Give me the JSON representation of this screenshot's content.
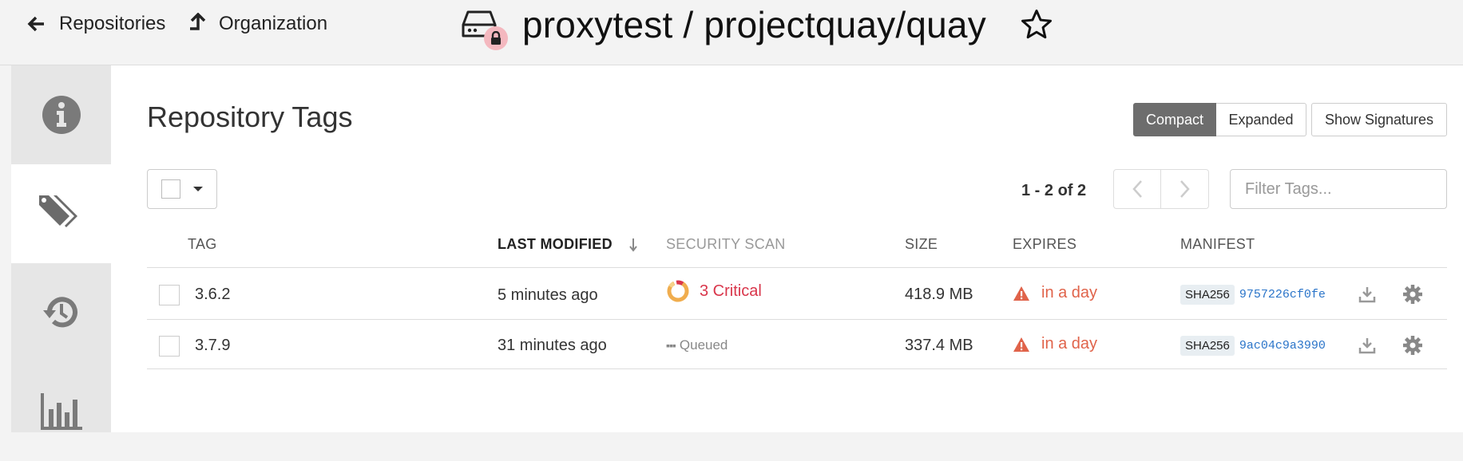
{
  "header": {
    "back_link": "Repositories",
    "org_link": "Organization",
    "repo_title": "proxytest / projectquay/quay"
  },
  "page": {
    "title": "Repository Tags",
    "view_buttons": [
      "Compact",
      "Expanded",
      "Show Signatures"
    ],
    "active_view": "Compact"
  },
  "toolbar": {
    "pager_text": "1 - 2 of 2",
    "filter_placeholder": "Filter Tags..."
  },
  "table": {
    "headers": {
      "tag": "TAG",
      "last_modified": "LAST MODIFIED",
      "security_scan": "SECURITY SCAN",
      "size": "SIZE",
      "expires": "EXPIRES",
      "manifest": "MANIFEST"
    },
    "rows": [
      {
        "tag": "3.6.2",
        "last_modified": "5 minutes ago",
        "security_scan": "3 Critical",
        "size": "418.9 MB",
        "expires": "in a day",
        "manifest_algo": "SHA256",
        "manifest_digest": "9757226cf0fe"
      },
      {
        "tag": "3.7.9",
        "last_modified": "31 minutes ago",
        "security_scan": "Queued",
        "size": "337.4 MB",
        "expires": "in a day",
        "manifest_algo": "SHA256",
        "manifest_digest": "9ac04c9a3990"
      }
    ]
  },
  "colors": {
    "critical": "#d9364b",
    "expires": "#e0634a",
    "digest_link": "#2a74c9",
    "active_button": "#6d6d6d"
  },
  "icons": {
    "sidebar": [
      "info-icon",
      "tag-icon",
      "history-icon",
      "bar-chart-icon"
    ],
    "row_actions": [
      "download-icon",
      "gear-icon"
    ]
  }
}
